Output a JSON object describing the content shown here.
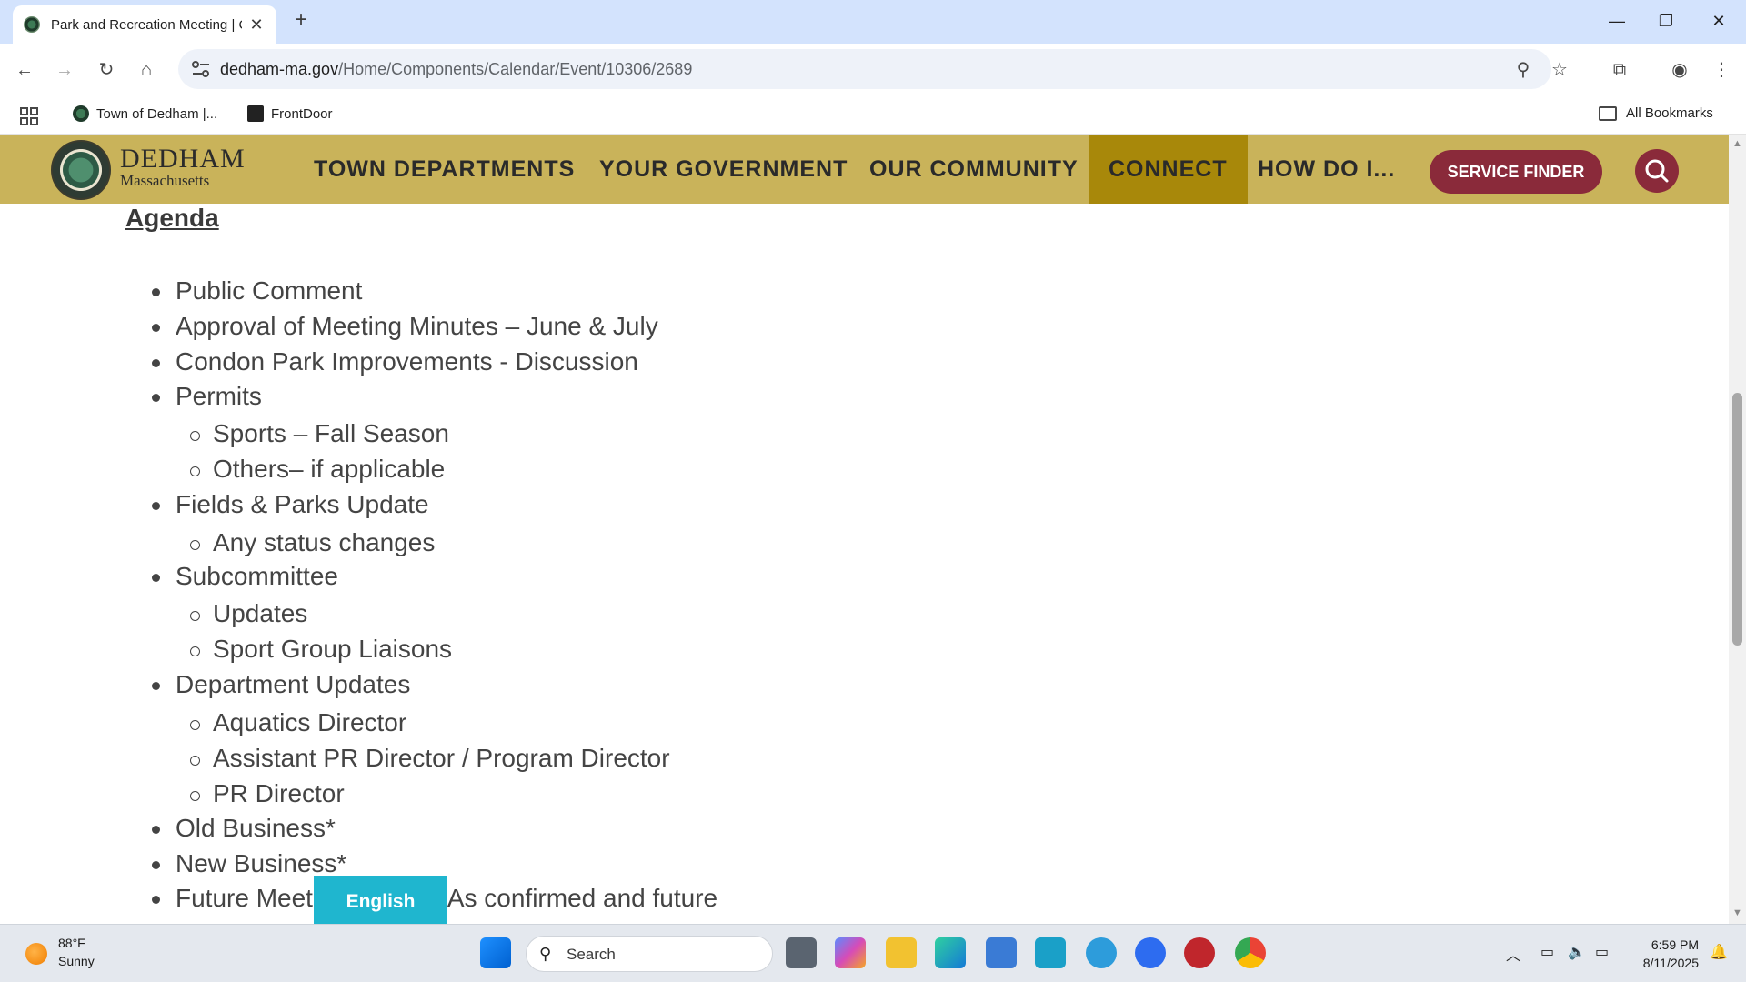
{
  "browser": {
    "tab_title": "Park and Recreation Meeting | C",
    "url_domain": "dedham-ma.gov",
    "url_path": "/Home/Components/Calendar/Event/10306/2689",
    "bookmarks": [
      "Town of Dedham |...",
      "FrontDoor"
    ],
    "all_bookmarks": "All Bookmarks"
  },
  "site": {
    "logo_town": "DEDHAM",
    "logo_state": "Massachusetts",
    "nav": [
      "TOWN DEPARTMENTS",
      "YOUR GOVERNMENT",
      "OUR COMMUNITY",
      "CONNECT",
      "HOW DO I..."
    ],
    "service_finder": "SERVICE FINDER"
  },
  "content": {
    "heading": "Agenda",
    "items": [
      {
        "text": "Public Comment",
        "level": 1
      },
      {
        "text": "Approval of Meeting Minutes – June & July",
        "level": 1
      },
      {
        "text": "Condon Park Improvements - Discussion",
        "level": 1
      },
      {
        "text": "Permits",
        "level": 1
      },
      {
        "text": "Sports – Fall Season",
        "level": 2
      },
      {
        "text": "Others– if applicable",
        "level": 2
      },
      {
        "text": "Fields & Parks Update",
        "level": 1
      },
      {
        "text": "Any status changes",
        "level": 2
      },
      {
        "text": "Subcommittee",
        "level": 1
      },
      {
        "text": "Updates",
        "level": 2
      },
      {
        "text": "Sport Group Liaisons",
        "level": 2
      },
      {
        "text": "Department Updates",
        "level": 1
      },
      {
        "text": "Aquatics Director",
        "level": 2
      },
      {
        "text": "Assistant PR Director / Program Director",
        "level": 2
      },
      {
        "text": "PR Director",
        "level": 2
      },
      {
        "text": "Old Business*",
        "level": 1
      },
      {
        "text": "New Business*",
        "level": 1
      },
      {
        "text": "Future Meeting Dates – As confirmed and future",
        "level": 1
      }
    ],
    "language_button": "English"
  },
  "taskbar": {
    "temperature": "88°F",
    "condition": "Sunny",
    "search_placeholder": "Search",
    "time": "6:59 PM",
    "date": "8/11/2025"
  },
  "colors": {
    "header_gold": "#c9b35a",
    "active_nav": "#a8880a",
    "button_maroon": "#8a2a3a",
    "language_teal": "#1fb6cf"
  }
}
